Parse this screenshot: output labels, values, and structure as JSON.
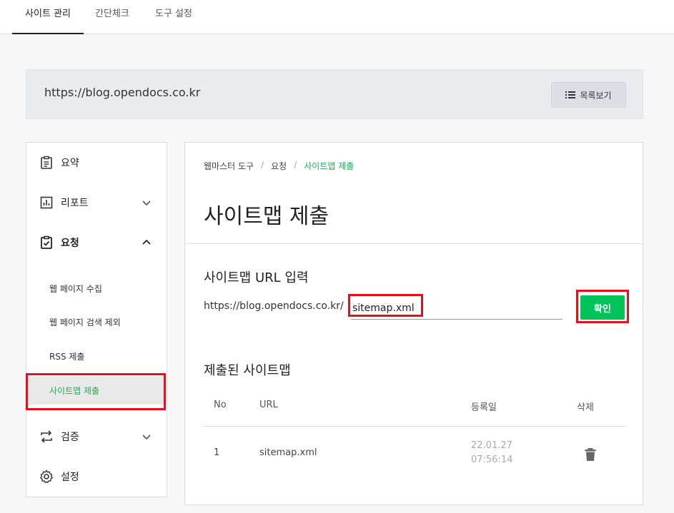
{
  "topnav": {
    "tabs": [
      {
        "label": "사이트 관리",
        "active": true
      },
      {
        "label": "간단체크",
        "active": false
      },
      {
        "label": "도구 설정",
        "active": false
      }
    ]
  },
  "site": {
    "url": "https://blog.opendocs.co.kr",
    "list_button": "목록보기"
  },
  "sidebar": {
    "summary": "요약",
    "report": "리포트",
    "request": "요청",
    "sub": {
      "collect": "웹 페이지 수집",
      "exclude": "웹 페이지 검색 제외",
      "rss": "RSS 제출",
      "sitemap": "사이트맵 제출"
    },
    "verify": "검증",
    "settings": "설정"
  },
  "main": {
    "breadcrumb": [
      "웹마스터 도구",
      "요청",
      "사이트맵 제출"
    ],
    "title": "사이트맵 제출",
    "input_section": "사이트맵 URL 입력",
    "prefix": "https://blog.opendocs.co.kr/",
    "input_value": "sitemap.xml",
    "confirm": "확인",
    "submitted_section": "제출된 사이트맵",
    "table": {
      "headers": [
        "No",
        "URL",
        "등록일",
        "삭제"
      ],
      "rows": [
        {
          "no": "1",
          "url": "sitemap.xml",
          "date": "22.01.27 07:56:14"
        }
      ]
    }
  },
  "colors": {
    "accent_green": "#00c35a",
    "highlight_red": "#e0121b"
  }
}
